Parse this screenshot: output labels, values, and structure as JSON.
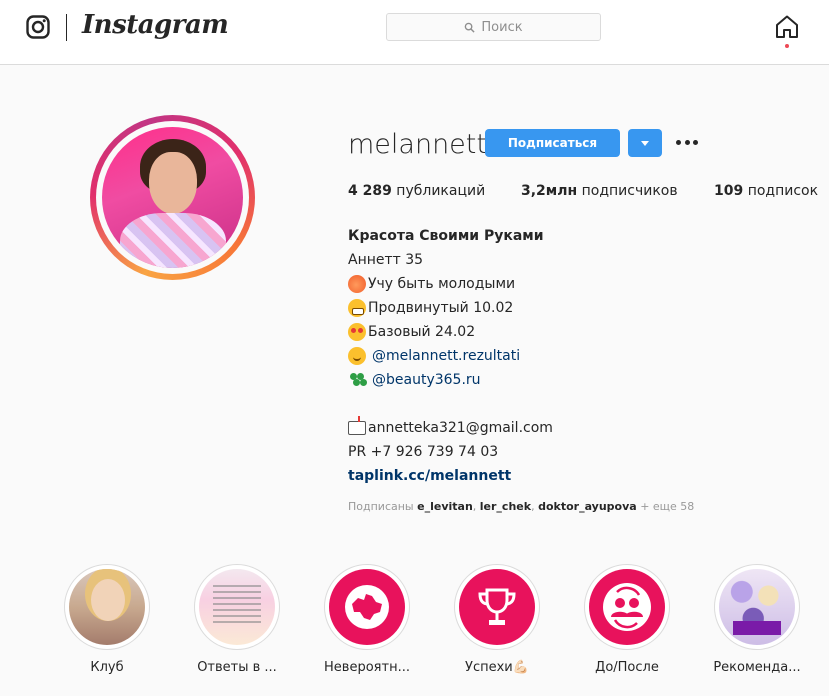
{
  "nav": {
    "brand": "Instagram",
    "search_placeholder": "Поиск"
  },
  "profile": {
    "username": "melannett",
    "follow_label": "Подписаться",
    "stats": {
      "posts_count": "4 289",
      "posts_label": "публикаций",
      "followers_count": "3,2млн",
      "followers_label": "подписчиков",
      "following_count": "109",
      "following_label": "подписок"
    },
    "bio": {
      "name": "Красота Своими Руками",
      "lines": [
        {
          "icon": "peach-icon",
          "text": "Аннетт 35"
        },
        {
          "icon": "peach-icon",
          "text": " Учу быть молодыми"
        },
        {
          "icon": "grin-icon",
          "text": "Продвинутый 10.02"
        },
        {
          "icon": "heart-eyes-icon",
          "text": "Базовый 24.02"
        },
        {
          "icon": "smile-icon",
          "text": "@melannett.rezultati"
        },
        {
          "icon": "clover-icon",
          "text": "@beauty365.ru"
        },
        {
          "icon": "mailbox-icon",
          "text": "annetteka321@gmail.com"
        }
      ],
      "phone": "PR +7 926 739 74 03",
      "website": "taplink.cc/melannett"
    },
    "followed_by": {
      "prefix": "Подписаны",
      "users": [
        "e_levitan",
        "ler_chek",
        "doktor_ayupova"
      ],
      "more": "+ еще 58"
    }
  },
  "highlights": [
    {
      "label": "Клуб"
    },
    {
      "label": "Ответы в ..."
    },
    {
      "label": "Невероятн..."
    },
    {
      "label": "Успехи💪🏻"
    },
    {
      "label": "До/После"
    },
    {
      "label": "Рекоменда..."
    }
  ],
  "colors": {
    "accent": "#3897f0",
    "highlight_pink": "#e8125c",
    "link": "#003569"
  }
}
